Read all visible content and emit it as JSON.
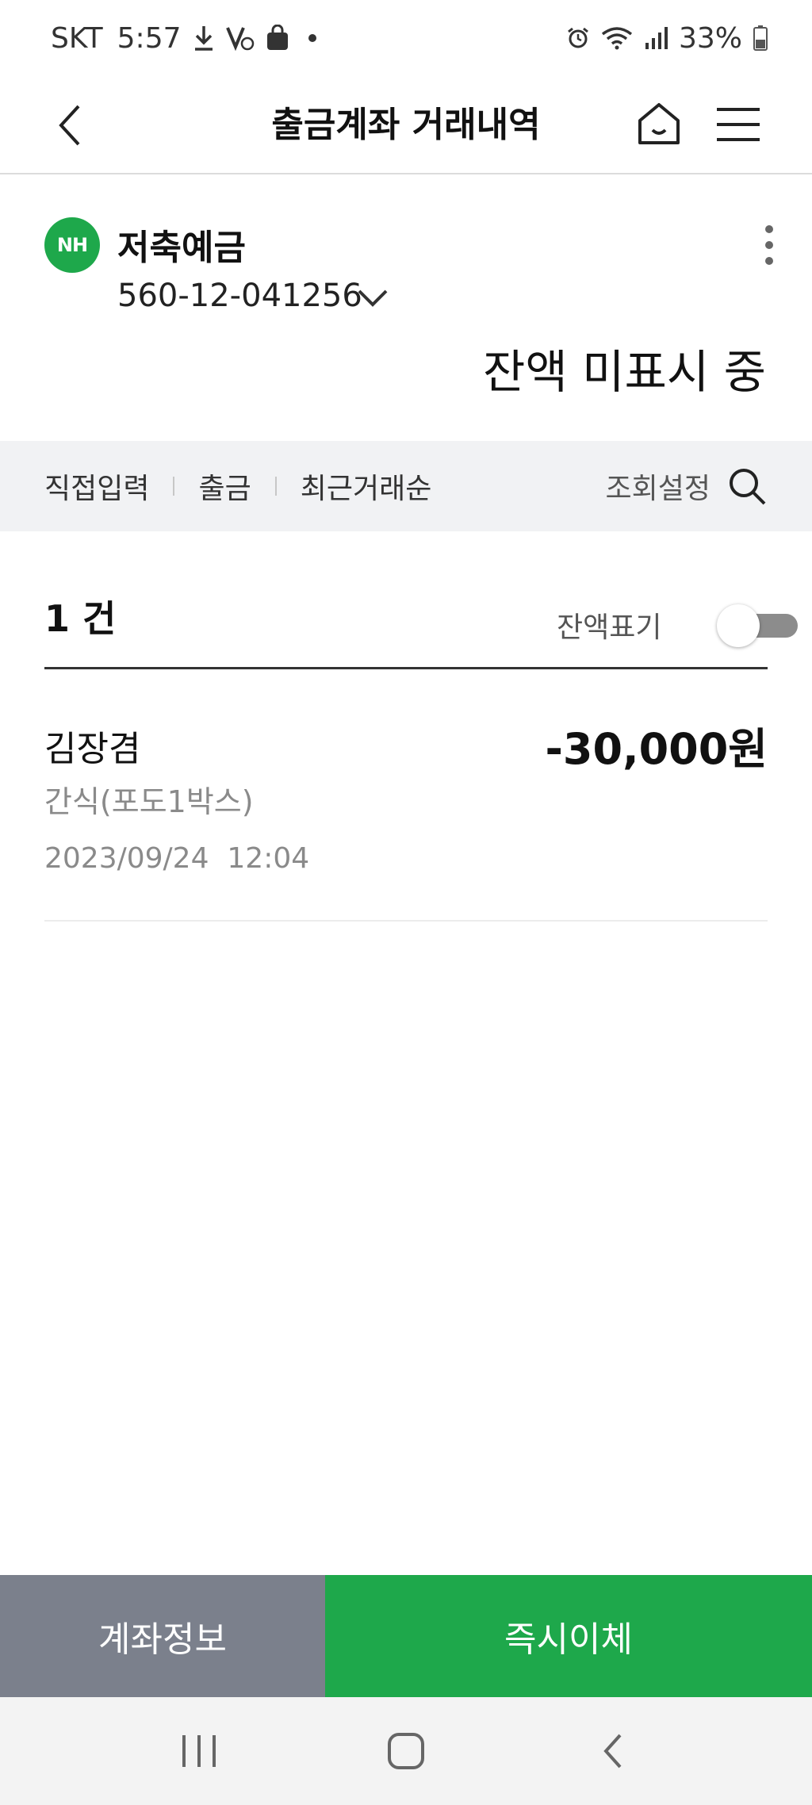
{
  "status_bar": {
    "carrier": "SKT",
    "time": "5:57",
    "battery": "33%"
  },
  "header": {
    "title": "출금계좌 거래내역"
  },
  "account": {
    "bank_logo_text": "NH",
    "name": "저축예금",
    "number": "560-12-041256",
    "balance_status": "잔액 미표시 중"
  },
  "filters": {
    "items": [
      "직접입력",
      "출금",
      "최근거래순"
    ],
    "settings_label": "조회설정"
  },
  "list": {
    "count_label": "1 건",
    "balance_toggle_label": "잔액표기",
    "balance_toggle_on": false,
    "transactions": [
      {
        "name": "김장겸",
        "amount": "-30,000원",
        "memo": "간식(포도1박스)",
        "datetime": "2023/09/24  12:04"
      }
    ]
  },
  "actions": {
    "account_info": "계좌정보",
    "instant_transfer": "즉시이체"
  },
  "colors": {
    "brand_green": "#1ea84b",
    "secondary_button": "#7b808c",
    "filter_bg": "#f1f2f4"
  }
}
